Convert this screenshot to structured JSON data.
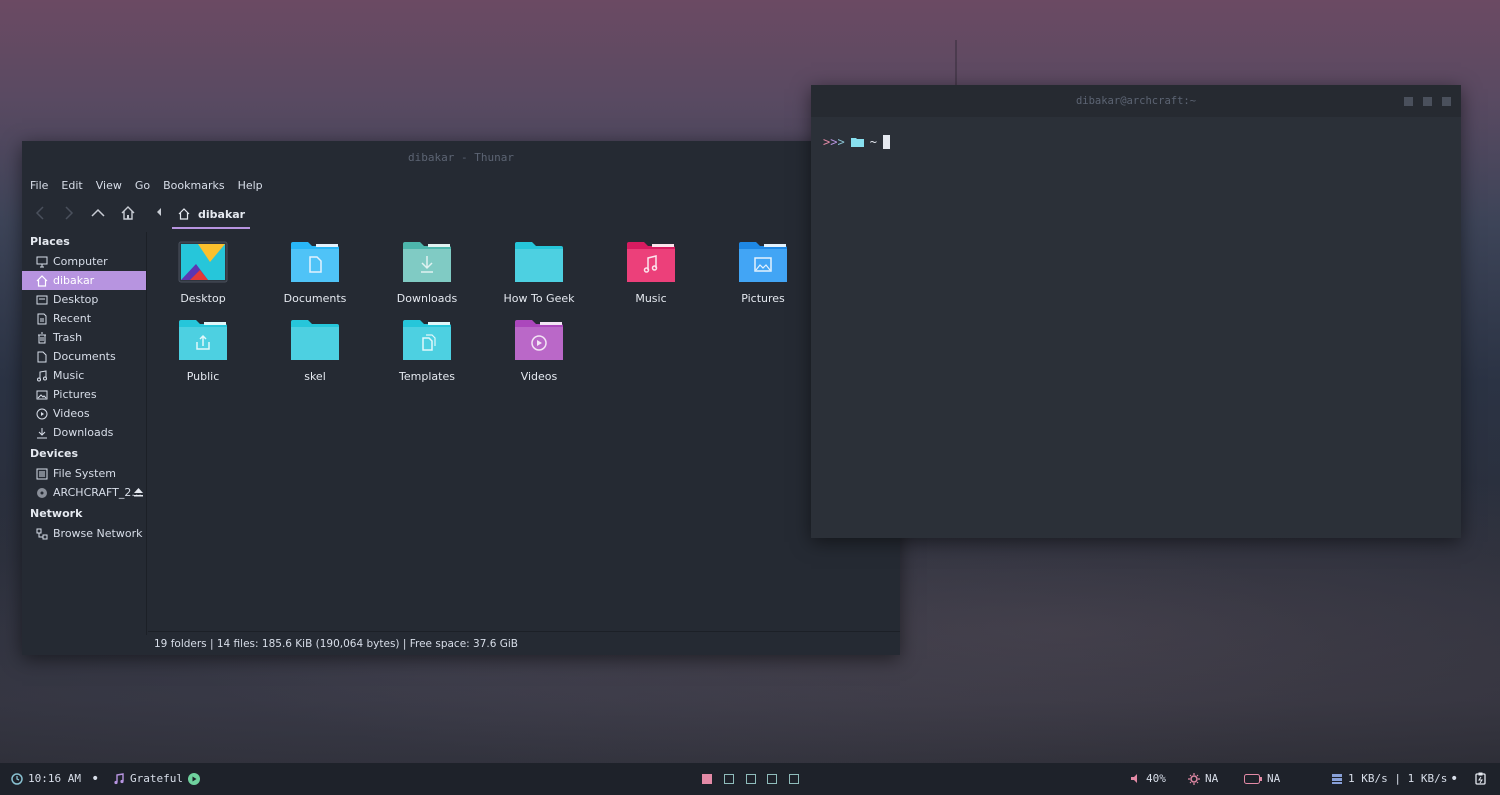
{
  "thunar": {
    "title": "dibakar - Thunar",
    "menu": [
      "File",
      "Edit",
      "View",
      "Go",
      "Bookmarks",
      "Help"
    ],
    "breadcrumb": "dibakar",
    "sidebar": {
      "places_title": "Places",
      "places": [
        "Computer",
        "dibakar",
        "Desktop",
        "Recent",
        "Trash",
        "Documents",
        "Music",
        "Pictures",
        "Videos",
        "Downloads"
      ],
      "devices_title": "Devices",
      "devices": [
        "File System",
        "ARCHCRAFT_2..."
      ],
      "network_title": "Network",
      "network": [
        "Browse Network"
      ]
    },
    "files": [
      "Desktop",
      "Documents",
      "Downloads",
      "How To Geek",
      "Music",
      "Pictures",
      "Public",
      "skel",
      "Templates",
      "Videos"
    ],
    "status": "19 folders  |  14 files: 185.6 KiB (190,064 bytes)  |  Free space: 37.6 GiB"
  },
  "terminal": {
    "title": "dibakar@archcraft:~",
    "prompt_arrows": ">>>",
    "cwd": "~"
  },
  "bar": {
    "time": "10:16 AM",
    "music": "Grateful",
    "volume": "40%",
    "brightness": "NA",
    "battery": "NA",
    "network": "1 KB/s | 1 KB/s"
  },
  "colors": {
    "accent": "#b794e0",
    "folder_blue": "#4fc3f7",
    "folder_teal": "#4dd0e1",
    "folder_pink": "#ec407a",
    "folder_purple": "#ba68c8",
    "folder_sky": "#42a5f5",
    "folder_mint": "#80cbc4"
  }
}
